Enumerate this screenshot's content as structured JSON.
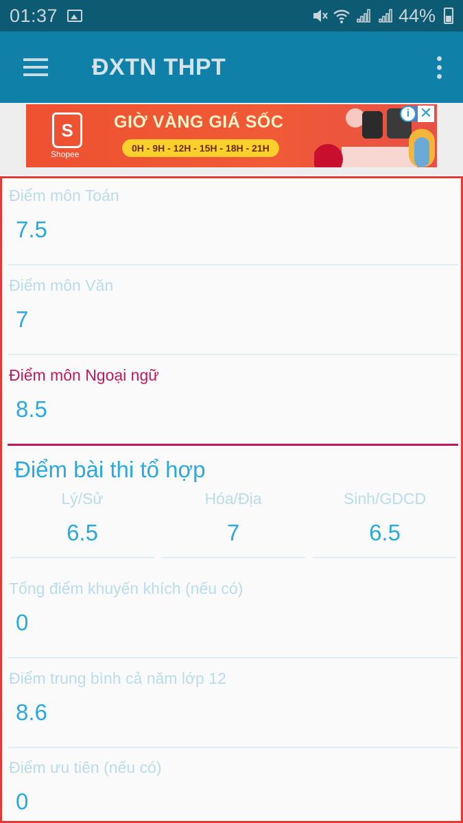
{
  "status_bar": {
    "time": "01:37",
    "battery": "44%",
    "icons": [
      "image-icon",
      "mute-icon",
      "wifi-icon",
      "signal-icon",
      "signal-icon",
      "battery-icon"
    ]
  },
  "app_bar": {
    "title": "ĐXTN THPT",
    "menu_icon": "menu-icon",
    "overflow_icon": "more-vert-icon"
  },
  "ad": {
    "brand": "Shopee",
    "logo_letter": "S",
    "headline": "GIỜ VÀNG GIÁ SỐC",
    "hours": "0H - 9H - 12H - 15H - 18H - 21H",
    "info_label": "i",
    "close_label": "✕"
  },
  "form": {
    "fields": [
      {
        "label": "Điểm môn Toán",
        "value": "7.5"
      },
      {
        "label": "Điểm môn Văn",
        "value": "7"
      },
      {
        "label": "Điểm môn Ngoại ngữ",
        "value": "8.5"
      }
    ],
    "combo_title": "Điểm bài thi tổ hợp",
    "combo": [
      {
        "label": "Lý/Sử",
        "value": "6.5"
      },
      {
        "label": "Hóa/Địa",
        "value": "7"
      },
      {
        "label": "Sinh/GDCD",
        "value": "6.5"
      }
    ],
    "extra_fields": [
      {
        "label": "Tổng điểm khuyến khích (nếu có)",
        "value": "0"
      },
      {
        "label": "Điểm trung bình cả năm lớp 12",
        "value": "8.6"
      },
      {
        "label": "Điểm ưu tiên (nếu có)",
        "value": "0"
      }
    ]
  },
  "colors": {
    "status_bar": "#0d5a73",
    "app_bar": "#0f80a7",
    "accent_focus": "#c2185b",
    "value_text": "#29a9e0",
    "highlight_border": "#e53935"
  }
}
